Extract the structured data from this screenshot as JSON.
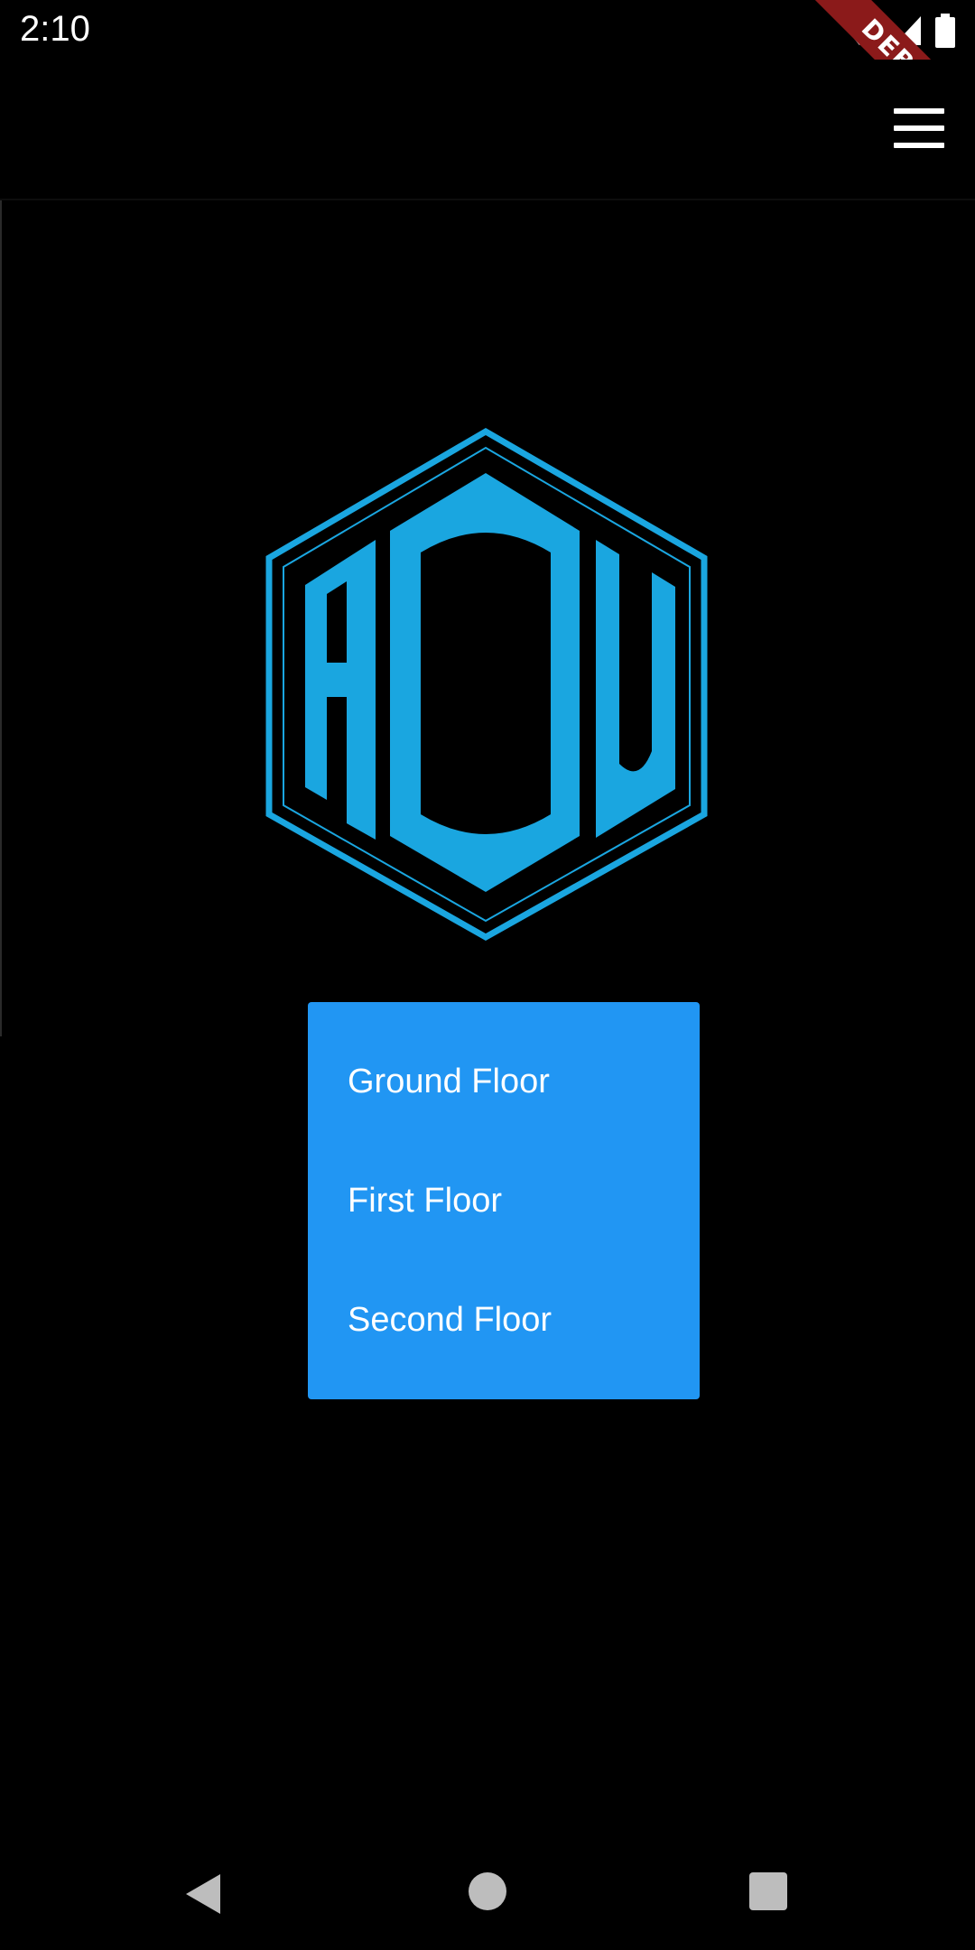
{
  "status_bar": {
    "time": "2:10",
    "icons": [
      "wifi-icon",
      "signal-icon",
      "battery-icon"
    ]
  },
  "debug_banner": {
    "label": "DEBUG",
    "color": "#8b1a1a"
  },
  "app_bar": {
    "menu_icon": "hamburger-menu-icon"
  },
  "logo": {
    "text": "ADU",
    "color": "#1aa6e0"
  },
  "floor_menu": {
    "background": "#2196f3",
    "items": [
      {
        "label": "Ground Floor"
      },
      {
        "label": "First Floor"
      },
      {
        "label": "Second Floor"
      }
    ]
  },
  "nav_bar": {
    "icons": [
      "back-icon",
      "home-icon",
      "recents-icon"
    ]
  }
}
